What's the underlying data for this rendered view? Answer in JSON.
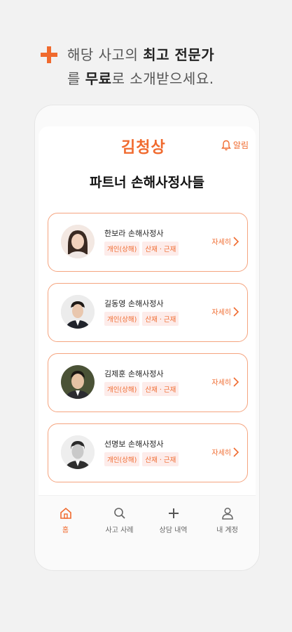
{
  "promo": {
    "line1_prefix": "해당 사고의 ",
    "line1_bold": "최고 전문가",
    "line2_prefix": "를 ",
    "line2_bold": "무료",
    "line2_suffix": "로 소개받으세요."
  },
  "header": {
    "logo": "김청상",
    "alarm_label": "알림"
  },
  "page_title": "파트너 손해사정사들",
  "partners": [
    {
      "name": "한보라 손해사정사",
      "tags": [
        "개인(상해)",
        "산재 · 근재"
      ],
      "detail": "자세히"
    },
    {
      "name": "길동영 손해사정사",
      "tags": [
        "개인(상해)",
        "산재 · 근재"
      ],
      "detail": "자세히"
    },
    {
      "name": "김제훈 손해사정사",
      "tags": [
        "개인(상해)",
        "산재 · 근재"
      ],
      "detail": "자세히"
    },
    {
      "name": "선명보 손해사정사",
      "tags": [
        "개인(상해)",
        "산재 · 근재"
      ],
      "detail": "자세히"
    }
  ],
  "tabs": [
    {
      "label": "홈",
      "icon": "home-icon",
      "active": true
    },
    {
      "label": "사고 사례",
      "icon": "search-icon",
      "active": false
    },
    {
      "label": "상담 내역",
      "icon": "plus-icon",
      "active": false
    },
    {
      "label": "내 계정",
      "icon": "user-icon",
      "active": false
    }
  ],
  "colors": {
    "accent": "#f06a2e",
    "tag_bg": "#fdecea",
    "card_border": "#f5a47f"
  }
}
